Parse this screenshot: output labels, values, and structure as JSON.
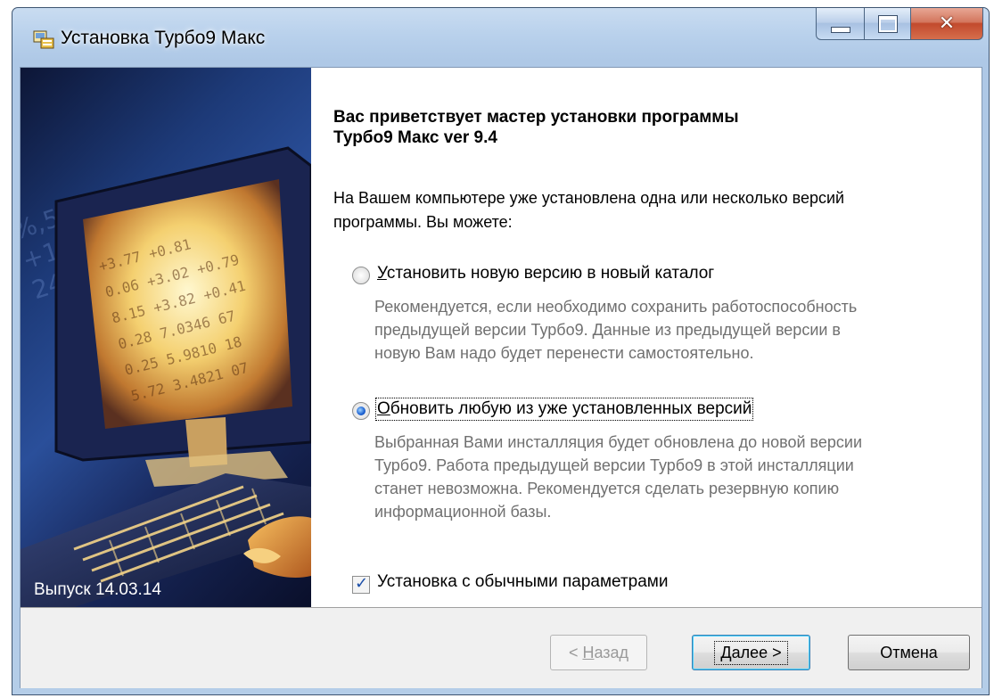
{
  "window": {
    "title": "Установка Турбо9 Макс",
    "controls": {
      "minimize": "minimize",
      "maximize": "maximize",
      "close": "✕"
    }
  },
  "sidebar": {
    "release_label": "Выпуск  14.03.14"
  },
  "content": {
    "heading_line1": "Вас приветствует мастер установки программы",
    "heading_line2": "Турбо9 Макс ver 9.4",
    "intro_line1": "На Вашем компьютере уже установлена одна или несколько версий",
    "intro_line2": "программы. Вы можете:",
    "options": [
      {
        "accel": "У",
        "label_rest": "становить новую версию в новый каталог",
        "selected": false,
        "desc": [
          "Рекомендуется, если необходимо сохранить работоспособность",
          "предыдущей версии Турбо9. Данные из предыдущей версии в",
          "новую Вам надо будет перенести самостоятельно."
        ]
      },
      {
        "accel": "О",
        "label_rest": "бновить любую из уже установленных версий",
        "selected": true,
        "desc": [
          "Выбранная Вами инсталляция будет обновлена до новой версии",
          "Турбо9. Работа предыдущей версии Турбо9 в этой инсталляции",
          "станет невозможна. Рекомендуется сделать резервную копию",
          "информационной базы."
        ]
      }
    ],
    "default_params": {
      "label": "Установка с обычными параметрами",
      "checked": true
    }
  },
  "footer": {
    "back": {
      "prefix": "< ",
      "accel": "Н",
      "rest": "азад",
      "enabled": false
    },
    "next": {
      "accel": "Д",
      "rest": "алее >",
      "enabled": true
    },
    "cancel": {
      "label": "Отмена",
      "enabled": true
    }
  },
  "colors": {
    "title_bar": "#b9d1ec",
    "sidebar_bg": "#1d3a78",
    "radio_selected": "#1a5fd0",
    "description_text": "#707070",
    "default_button_border": "#3c7fb1"
  }
}
